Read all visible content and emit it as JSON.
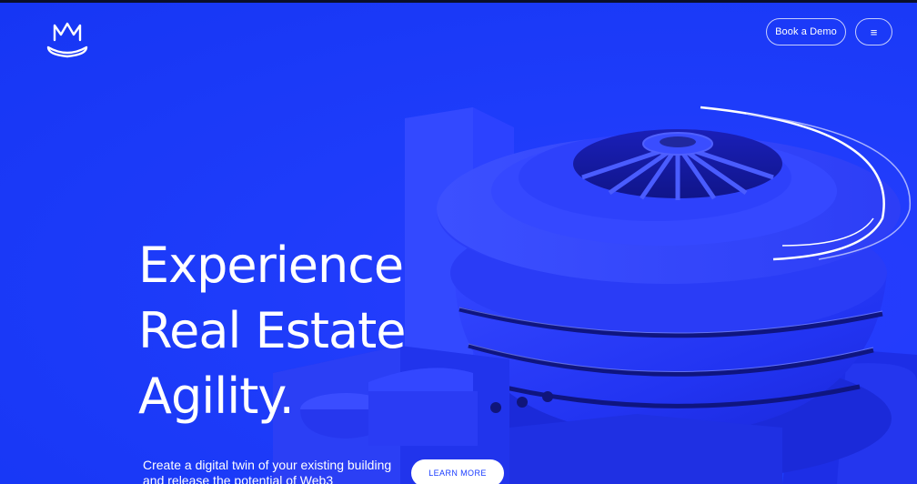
{
  "brand": {
    "logo_icon": "crowned-m-logo-icon"
  },
  "header": {
    "demo_button_label": "Book a Demo",
    "menu_button_label": "≡",
    "menu_icon": "hamburger-menu-icon"
  },
  "hero": {
    "headline_lines": [
      "Experience",
      "Real Estate",
      "Agility."
    ],
    "subtext_lines": [
      "Create a digital twin of your existing building",
      "and release the potential of Web3"
    ],
    "cta_label": "LEARN MORE",
    "illustration": "spiral-museum-building-render"
  },
  "colors": {
    "background": "#1a3cff",
    "text": "#ffffff",
    "accent_building": "#2b3cf5"
  }
}
